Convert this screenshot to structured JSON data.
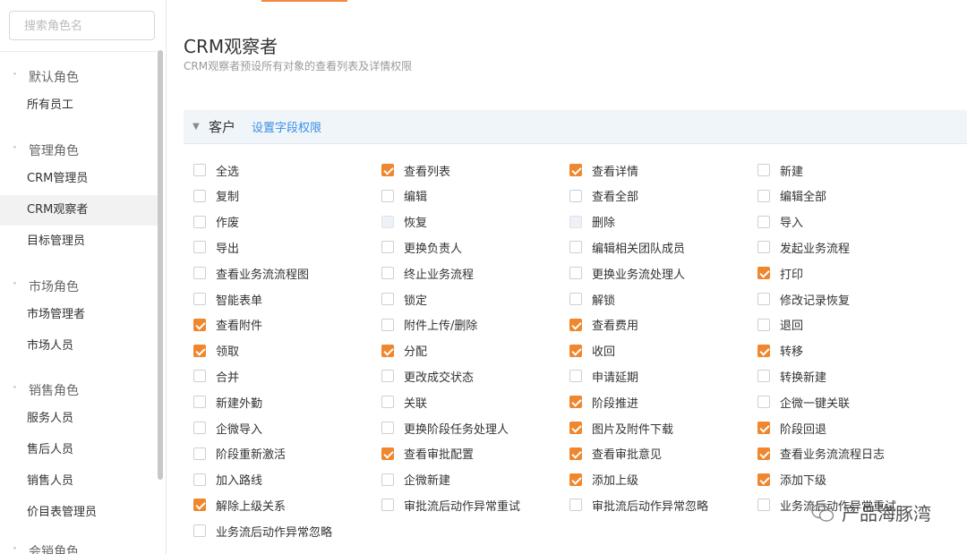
{
  "sidebar": {
    "search_placeholder": "搜索角色名",
    "groups": [
      {
        "label": "默认角色",
        "items": [
          {
            "label": "所有员工",
            "active": false
          }
        ]
      },
      {
        "label": "管理角色",
        "items": [
          {
            "label": "CRM管理员",
            "active": false
          },
          {
            "label": "CRM观察者",
            "active": true
          },
          {
            "label": "目标管理员",
            "active": false
          }
        ]
      },
      {
        "label": "市场角色",
        "items": [
          {
            "label": "市场管理者",
            "active": false
          },
          {
            "label": "市场人员",
            "active": false
          }
        ]
      },
      {
        "label": "销售角色",
        "items": [
          {
            "label": "服务人员",
            "active": false
          },
          {
            "label": "售后人员",
            "active": false
          },
          {
            "label": "销售人员",
            "active": false
          },
          {
            "label": "价目表管理员",
            "active": false
          }
        ]
      },
      {
        "label": "会销角色",
        "items": []
      }
    ]
  },
  "main": {
    "title": "CRM观察者",
    "subtitle": "CRM观察者预设所有对象的查看列表及详情权限",
    "section": {
      "title": "客户",
      "link": "设置字段权限"
    },
    "permissions": [
      {
        "label": "全选",
        "state": "unchecked"
      },
      {
        "label": "查看列表",
        "state": "checked"
      },
      {
        "label": "查看详情",
        "state": "checked"
      },
      {
        "label": "新建",
        "state": "unchecked"
      },
      {
        "label": "复制",
        "state": "unchecked"
      },
      {
        "label": "编辑",
        "state": "unchecked"
      },
      {
        "label": "查看全部",
        "state": "unchecked"
      },
      {
        "label": "编辑全部",
        "state": "unchecked"
      },
      {
        "label": "作废",
        "state": "unchecked"
      },
      {
        "label": "恢复",
        "state": "disabled"
      },
      {
        "label": "删除",
        "state": "disabled"
      },
      {
        "label": "导入",
        "state": "unchecked"
      },
      {
        "label": "导出",
        "state": "unchecked"
      },
      {
        "label": "更换负责人",
        "state": "unchecked"
      },
      {
        "label": "编辑相关团队成员",
        "state": "unchecked"
      },
      {
        "label": "发起业务流程",
        "state": "unchecked"
      },
      {
        "label": "查看业务流流程图",
        "state": "unchecked"
      },
      {
        "label": "终止业务流程",
        "state": "unchecked"
      },
      {
        "label": "更换业务流处理人",
        "state": "unchecked"
      },
      {
        "label": "打印",
        "state": "checked"
      },
      {
        "label": "智能表单",
        "state": "unchecked"
      },
      {
        "label": "锁定",
        "state": "unchecked"
      },
      {
        "label": "解锁",
        "state": "unchecked"
      },
      {
        "label": "修改记录恢复",
        "state": "unchecked"
      },
      {
        "label": "查看附件",
        "state": "checked"
      },
      {
        "label": "附件上传/删除",
        "state": "unchecked"
      },
      {
        "label": "查看费用",
        "state": "checked"
      },
      {
        "label": "退回",
        "state": "unchecked"
      },
      {
        "label": "领取",
        "state": "checked"
      },
      {
        "label": "分配",
        "state": "checked"
      },
      {
        "label": "收回",
        "state": "checked"
      },
      {
        "label": "转移",
        "state": "checked"
      },
      {
        "label": "合并",
        "state": "unchecked"
      },
      {
        "label": "更改成交状态",
        "state": "unchecked"
      },
      {
        "label": "申请延期",
        "state": "unchecked"
      },
      {
        "label": "转换新建",
        "state": "unchecked"
      },
      {
        "label": "新建外勤",
        "state": "unchecked"
      },
      {
        "label": "关联",
        "state": "unchecked"
      },
      {
        "label": "阶段推进",
        "state": "checked"
      },
      {
        "label": "企微一键关联",
        "state": "unchecked"
      },
      {
        "label": "企微导入",
        "state": "unchecked"
      },
      {
        "label": "更换阶段任务处理人",
        "state": "unchecked"
      },
      {
        "label": "图片及附件下载",
        "state": "checked"
      },
      {
        "label": "阶段回退",
        "state": "checked"
      },
      {
        "label": "阶段重新激活",
        "state": "unchecked"
      },
      {
        "label": "查看审批配置",
        "state": "checked"
      },
      {
        "label": "查看审批意见",
        "state": "checked"
      },
      {
        "label": "查看业务流流程日志",
        "state": "checked"
      },
      {
        "label": "加入路线",
        "state": "unchecked"
      },
      {
        "label": "企微新建",
        "state": "unchecked"
      },
      {
        "label": "添加上级",
        "state": "checked"
      },
      {
        "label": "添加下级",
        "state": "checked"
      },
      {
        "label": "解除上级关系",
        "state": "checked"
      },
      {
        "label": "审批流后动作异常重试",
        "state": "unchecked"
      },
      {
        "label": "审批流后动作异常忽略",
        "state": "unchecked"
      },
      {
        "label": "业务流后动作异常重试",
        "state": "unchecked"
      },
      {
        "label": "业务流后动作异常忽略",
        "state": "unchecked"
      }
    ]
  },
  "watermark": {
    "text": "产品海豚湾",
    "icon": "wechat-icon"
  },
  "colors": {
    "accent": "#f0862d",
    "link": "#3a8ee6",
    "section_bg": "#f0f5fa"
  }
}
